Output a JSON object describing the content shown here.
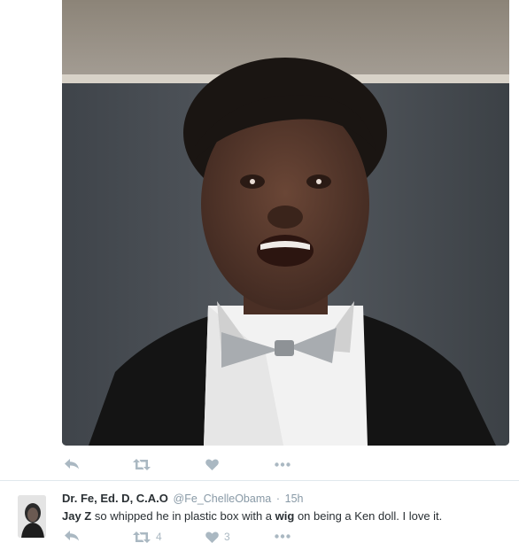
{
  "tweet_media": {
    "alt": "photo"
  },
  "tweet1_actions": {
    "reply_icon": "reply-icon",
    "retweet_icon": "retweet-icon",
    "like_icon": "heart-icon",
    "more_icon": "more-dots-icon"
  },
  "tweet2": {
    "fullname": "Dr. Fe, Ed. D, C.A.O",
    "screen_name": "@Fe_ChelleObama",
    "separator": "·",
    "time": "15h",
    "text_part1": "Jay Z",
    "text_part2": " so whipped he in plastic box with a ",
    "text_part3": "wig",
    "text_part4": " on being a Ken doll. I love it.",
    "retweet_count": "4",
    "like_count": "3"
  },
  "colors": {
    "action_gray": "#aab8c2",
    "meta_gray": "#8899a6",
    "text": "#292f33",
    "divider": "#e1e8ed"
  }
}
